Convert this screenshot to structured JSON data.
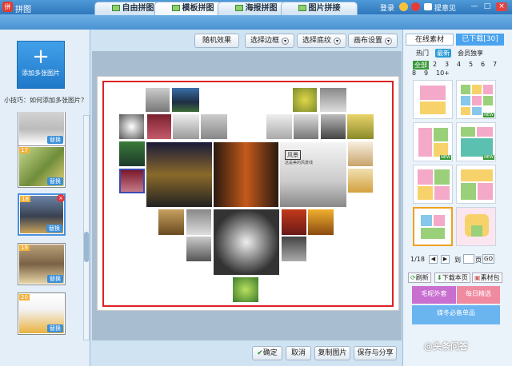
{
  "app": {
    "title": "拼图",
    "login": "登录",
    "feedback": "提意见",
    "logo_char": "拼"
  },
  "window": {
    "min": "—",
    "max": "□",
    "close": "×"
  },
  "tabs": [
    {
      "label": "自由拼图"
    },
    {
      "label": "模板拼图"
    },
    {
      "label": "海报拼图"
    },
    {
      "label": "图片拼接"
    }
  ],
  "left": {
    "add_label": "添加多张图片",
    "add_icon": "+",
    "tips": "小技巧：如何添加多张图片？",
    "thumbs": [
      {
        "num": "",
        "replace": "替换"
      },
      {
        "num": "17",
        "replace": "替换"
      },
      {
        "num": "18",
        "replace": "替换",
        "delete": "×"
      },
      {
        "num": "19",
        "replace": "替换"
      },
      {
        "num": "20",
        "replace": "替换"
      }
    ]
  },
  "toolbar": {
    "random": "随机效果",
    "border": "选择边框",
    "bg": "选择底纹",
    "canvas": "画布设置"
  },
  "canvas_text": {
    "caption": "风景",
    "quote": "这是美的风景线"
  },
  "bottom": {
    "ok": "确定",
    "cancel": "取消",
    "copy": "复制图片",
    "save": "保存与分享"
  },
  "right": {
    "tab_online": "在线素材",
    "tab_downloaded": "已下载[30]",
    "cats": [
      "热门",
      "最新",
      "会员独享"
    ],
    "nums": [
      "全部",
      "2",
      "3",
      "4",
      "5",
      "6",
      "7",
      "8",
      "9",
      "10+"
    ],
    "new_tag": "NEW",
    "pager": {
      "current": "1/18",
      "goto": "到",
      "page": "页",
      "go": "GO"
    },
    "refresh": "刷新",
    "download_page": "下载本页",
    "pack": "素材包",
    "ads": [
      "毛呢外套",
      "每日精选",
      "媒冬必备单品"
    ]
  },
  "watermark": "@头条问答",
  "colors": {
    "accent": "#2f77bd",
    "frame": "#dd2222"
  }
}
